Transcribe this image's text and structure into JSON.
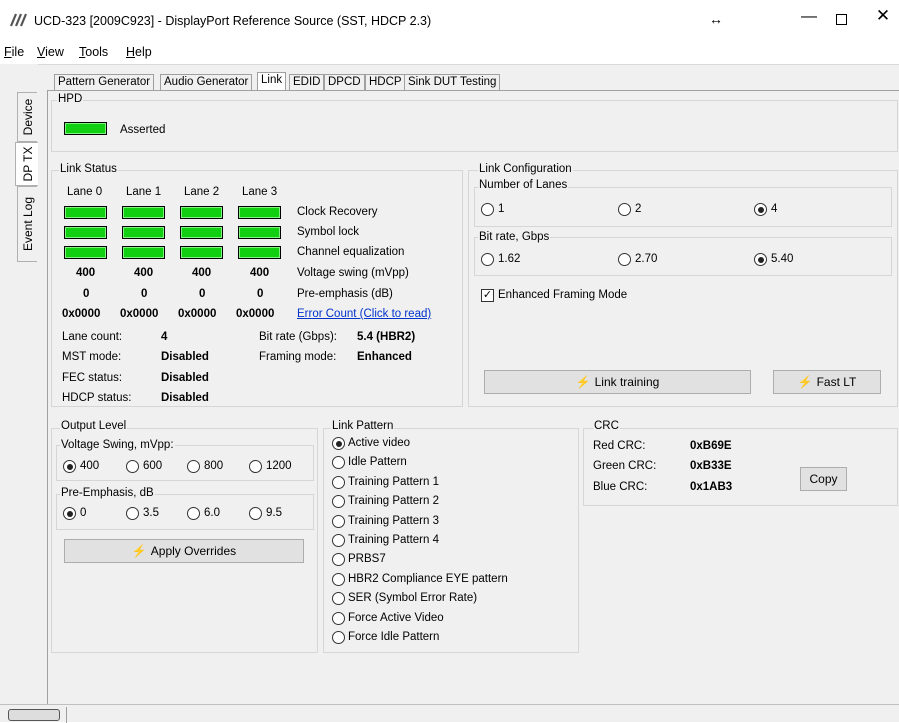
{
  "window": {
    "title": "UCD-323 [2009C923] - DisplayPort Reference Source (SST, HDCP 2.3)",
    "resize_glyph": "↔",
    "min_glyph": "—",
    "close_glyph": "✕"
  },
  "menu": [
    {
      "pre": "",
      "key": "F",
      "post": "ile"
    },
    {
      "pre": "",
      "key": "V",
      "post": "iew"
    },
    {
      "pre": "",
      "key": "T",
      "post": "ools"
    },
    {
      "pre": "",
      "key": "H",
      "post": "elp"
    }
  ],
  "side_tabs": [
    "Device",
    "DP TX",
    "Event Log"
  ],
  "tabs": [
    "Pattern Generator",
    "Audio Generator",
    "Link",
    "EDID",
    "DPCD",
    "HDCP",
    "Sink DUT Testing"
  ],
  "hpd": {
    "title": "HPD",
    "status": "Asserted"
  },
  "link_status": {
    "title": "Link Status",
    "lanes": [
      "Lane 0",
      "Lane 1",
      "Lane 2",
      "Lane 3"
    ],
    "row_labels": [
      "Clock Recovery",
      "Symbol lock",
      "Channel equalization",
      "Voltage swing (mVpp)",
      "Pre-emphasis (dB)"
    ],
    "voltage": [
      "400",
      "400",
      "400",
      "400"
    ],
    "preemph": [
      "0",
      "0",
      "0",
      "0"
    ],
    "errors": [
      "0x0000",
      "0x0000",
      "0x0000",
      "0x0000"
    ],
    "error_link": "Error Count (Click to read)",
    "lane_count_label": "Lane count:",
    "lane_count": "4",
    "bit_rate_label": "Bit rate (Gbps):",
    "bit_rate": "5.4 (HBR2)",
    "mst_label": "MST mode:",
    "mst": "Disabled",
    "framing_label": "Framing mode:",
    "framing": "Enhanced",
    "fec_label": "FEC status:",
    "fec": "Disabled",
    "hdcp_label": "HDCP status:",
    "hdcp": "Disabled"
  },
  "link_config": {
    "title": "Link Configuration",
    "lanes_title": "Number of Lanes",
    "lanes_options": [
      "1",
      "2",
      "4"
    ],
    "lanes_selected": "4",
    "rate_title": "Bit rate, Gbps",
    "rate_options": [
      "1.62",
      "2.70",
      "5.40"
    ],
    "rate_selected": "5.40",
    "enhanced_label": "Enhanced Framing Mode",
    "enhanced_checked": true,
    "check_glyph": "✓",
    "train_button": "Link training",
    "fast_button": "Fast LT",
    "bolt_icon": "⚡"
  },
  "output_level": {
    "title": "Output Level",
    "vs_title": "Voltage Swing,  mVpp:",
    "vs_options": [
      "400",
      "600",
      "800",
      "1200"
    ],
    "vs_selected": "400",
    "pe_title": "Pre-Emphasis,  dB",
    "pe_options": [
      "0",
      "3.5",
      "6.0",
      "9.5"
    ],
    "pe_selected": "0",
    "apply_button": "Apply Overrides"
  },
  "link_pattern": {
    "title": "Link Pattern",
    "options": [
      "Active video",
      "Idle Pattern",
      "Training Pattern 1",
      "Training Pattern 2",
      "Training Pattern 3",
      "Training Pattern 4",
      "PRBS7",
      "HBR2 Compliance EYE pattern",
      "SER (Symbol Error Rate)",
      "Force Active Video",
      "Force Idle Pattern"
    ],
    "selected": "Active video"
  },
  "crc": {
    "title": "CRC",
    "rows": [
      {
        "label": "Red CRC:",
        "value": "0xB69E"
      },
      {
        "label": "Green CRC:",
        "value": "0xB33E"
      },
      {
        "label": "Blue CRC:",
        "value": "0x1AB3"
      }
    ],
    "copy_button": "Copy"
  },
  "colors": {
    "led_on": "#11d011",
    "link": "#0033cc"
  }
}
